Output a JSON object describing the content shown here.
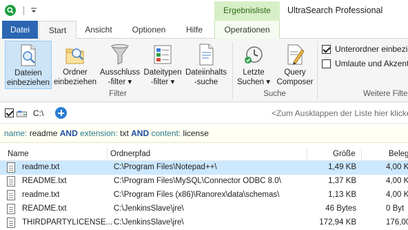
{
  "titlebar": {
    "context_tab_header": "Ergebnisliste",
    "window_title": "UltraSearch Professional"
  },
  "tabs": {
    "file": "Datei",
    "start": "Start",
    "ansicht": "Ansicht",
    "optionen": "Optionen",
    "hilfe": "Hilfe",
    "operationen": "Operationen"
  },
  "ribbon": {
    "filter_group": {
      "label": "Filter",
      "buttons": [
        {
          "line1": "Dateien",
          "line2": "einbeziehen",
          "icon": "document-search-icon"
        },
        {
          "line1": "Ordner",
          "line2": "einbeziehen",
          "icon": "folder-search-icon"
        },
        {
          "line1": "Ausschluss",
          "line2": "-filter ▾",
          "icon": "funnel-icon"
        },
        {
          "line1": "Dateitypen",
          "line2": "-filter ▾",
          "icon": "file-types-icon"
        },
        {
          "line1": "Dateiinhalts",
          "line2": "-suche",
          "icon": "file-content-icon"
        }
      ]
    },
    "suche_group": {
      "label": "Suche",
      "buttons": [
        {
          "line1": "Letzte",
          "line2": "Suchen ▾",
          "icon": "clock-icon"
        },
        {
          "line1": "Query",
          "line2": "Composer",
          "icon": "query-composer-icon"
        }
      ]
    },
    "weitere_group": {
      "label": "Weitere Filte",
      "options": [
        {
          "label": "Unterordner einbezi",
          "checked": true
        },
        {
          "label": "Umlaute und Akzente",
          "checked": false
        }
      ]
    }
  },
  "pathbar": {
    "path": "C:\\",
    "hint": "<Zum Ausklappen der Liste hier klicke"
  },
  "query": {
    "k1": "name:",
    "v1": "readme",
    "op1": "AND",
    "k2": "extension:",
    "v2": "txt",
    "op2": "AND",
    "k3": "content:",
    "v3": "license"
  },
  "list": {
    "columns": {
      "name": "Name",
      "path": "Ordnerpfad",
      "size": "Größe",
      "alloc": "Beleg"
    },
    "rows": [
      {
        "name": "readme.txt",
        "path": "C:\\Program Files\\Notepad++\\",
        "size": "1,49 KB",
        "alloc": "4,00 K"
      },
      {
        "name": "README.txt",
        "path": "C:\\Program Files\\MySQL\\Connector ODBC 8.0\\",
        "size": "1,37 KB",
        "alloc": "4,00 K"
      },
      {
        "name": "readme.txt",
        "path": "C:\\Program Files (x86)\\Ranorex\\data\\schemas\\",
        "size": "1,13 KB",
        "alloc": "4,00 K"
      },
      {
        "name": "README.txt",
        "path": "C:\\JenkinsSlave\\jre\\",
        "size": "46 Bytes",
        "alloc": "0 Byt"
      },
      {
        "name": "THIRDPARTYLICENSE...",
        "path": "C:\\JenkinsSlave\\jre\\",
        "size": "172,94 KB",
        "alloc": "176,00 K"
      }
    ],
    "selected_index": 0
  },
  "colors": {
    "accent": "#2b66b3",
    "context_tab": "#d7efc6",
    "selection": "#cce8ff"
  }
}
